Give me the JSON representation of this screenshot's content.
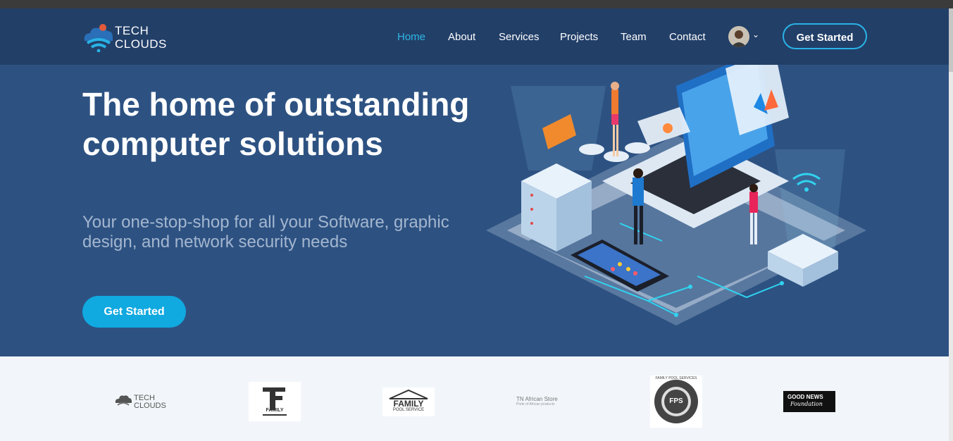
{
  "brand": {
    "line1": "TECH",
    "line2": "CLOUDS"
  },
  "nav": {
    "items": [
      {
        "label": "Home",
        "active": true
      },
      {
        "label": "About"
      },
      {
        "label": "Services"
      },
      {
        "label": "Projects"
      },
      {
        "label": "Team"
      },
      {
        "label": "Contact"
      }
    ],
    "cta_label": "Get Started"
  },
  "hero": {
    "title": "The home of outstanding computer solutions",
    "subtitle": "Your one-stop-shop for all your Software, graphic design, and network security needs",
    "cta_label": "Get Started"
  },
  "clients": {
    "techclouds": {
      "line1": "TECH",
      "line2": "CLOUDS"
    },
    "family": {
      "label": "FAMILY"
    },
    "family_pool": {
      "label": "FAMILY",
      "sub": "POOL SERVICE"
    },
    "african_store": {
      "label": "TN African Store",
      "sub": "Pride of African products"
    },
    "fps": {
      "label": "FAMILY POOL SERVICES",
      "mono": "FPS"
    },
    "good_news": {
      "line1": "GOOD NEWS",
      "line2": "Foundation"
    }
  },
  "colors": {
    "accent": "#10a9e0",
    "header": "#223f68",
    "hero": "#2d5282"
  }
}
